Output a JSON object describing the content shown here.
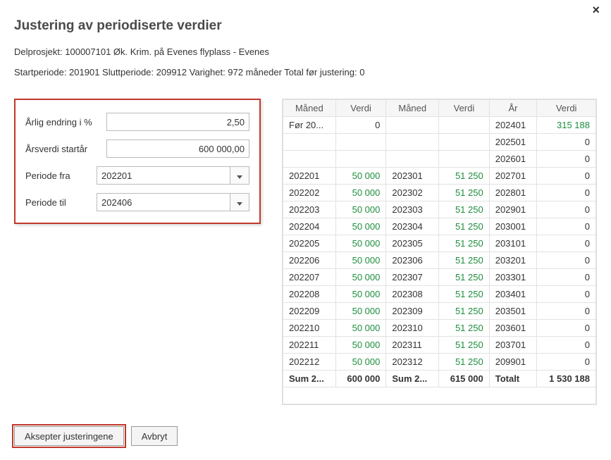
{
  "close_label": "×",
  "title": "Justering av periodiserte verdier",
  "subproject_line": "Delprosjekt: 100007101 Øk. Krim. på Evenes flyplass - Evenes",
  "period_line": "Startperiode: 201901 Sluttperiode: 209912 Varighet: 972 måneder Total før justering: 0",
  "form": {
    "annual_change_label": "Årlig endring i %",
    "annual_change_value": "2,50",
    "start_value_label": "Årsverdi startår",
    "start_value_value": "600 000,00",
    "period_from_label": "Periode fra",
    "period_from_value": "202201",
    "period_to_label": "Periode til",
    "period_to_value": "202406"
  },
  "table": {
    "headers": [
      "Måned",
      "Verdi",
      "Måned",
      "Verdi",
      "År",
      "Verdi"
    ],
    "top_rows": [
      {
        "c0": "Før 20...",
        "c1": "0",
        "c2": "",
        "c3": "",
        "c4": "202401",
        "c5": "315 188",
        "c5_green": true
      },
      {
        "c0": "",
        "c1": "",
        "c2": "",
        "c3": "",
        "c4": "202501",
        "c5": "0"
      },
      {
        "c0": "",
        "c1": "",
        "c2": "",
        "c3": "",
        "c4": "202601",
        "c5": "0"
      }
    ],
    "month_rows": [
      {
        "m1": "202201",
        "v1": "50 000",
        "m2": "202301",
        "v2": "51 250",
        "y": "202701",
        "yv": "0"
      },
      {
        "m1": "202202",
        "v1": "50 000",
        "m2": "202302",
        "v2": "51 250",
        "y": "202801",
        "yv": "0"
      },
      {
        "m1": "202203",
        "v1": "50 000",
        "m2": "202303",
        "v2": "51 250",
        "y": "202901",
        "yv": "0"
      },
      {
        "m1": "202204",
        "v1": "50 000",
        "m2": "202304",
        "v2": "51 250",
        "y": "203001",
        "yv": "0"
      },
      {
        "m1": "202205",
        "v1": "50 000",
        "m2": "202305",
        "v2": "51 250",
        "y": "203101",
        "yv": "0"
      },
      {
        "m1": "202206",
        "v1": "50 000",
        "m2": "202306",
        "v2": "51 250",
        "y": "203201",
        "yv": "0"
      },
      {
        "m1": "202207",
        "v1": "50 000",
        "m2": "202307",
        "v2": "51 250",
        "y": "203301",
        "yv": "0"
      },
      {
        "m1": "202208",
        "v1": "50 000",
        "m2": "202308",
        "v2": "51 250",
        "y": "203401",
        "yv": "0"
      },
      {
        "m1": "202209",
        "v1": "50 000",
        "m2": "202309",
        "v2": "51 250",
        "y": "203501",
        "yv": "0"
      },
      {
        "m1": "202210",
        "v1": "50 000",
        "m2": "202310",
        "v2": "51 250",
        "y": "203601",
        "yv": "0"
      },
      {
        "m1": "202211",
        "v1": "50 000",
        "m2": "202311",
        "v2": "51 250",
        "y": "203701",
        "yv": "0"
      },
      {
        "m1": "202212",
        "v1": "50 000",
        "m2": "202312",
        "v2": "51 250",
        "y": "209901",
        "yv": "0"
      }
    ],
    "sum_row": {
      "c0": "Sum 2...",
      "c1": "600 000",
      "c2": "Sum 2...",
      "c3": "615 000",
      "c4": "Totalt",
      "c5": "1 530 188"
    }
  },
  "footer": {
    "accept": "Aksepter justeringene",
    "cancel": "Avbryt"
  }
}
